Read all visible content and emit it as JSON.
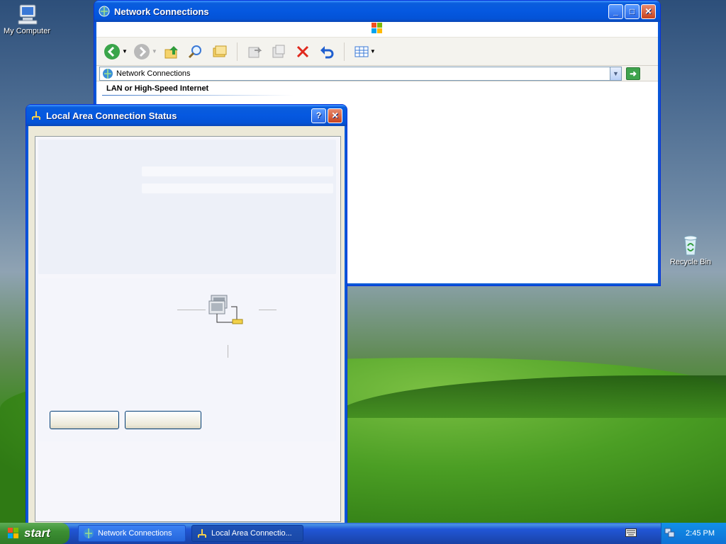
{
  "desktop": {
    "icons": [
      {
        "label": "My Computer"
      },
      {
        "label": "Recycle Bin"
      }
    ]
  },
  "network_window": {
    "title": "Network Connections",
    "address": "Network Connections",
    "group_header": "LAN or High-Speed Internet"
  },
  "status_dialog": {
    "title": "Local Area Connection Status"
  },
  "taskbar": {
    "start_label": "start",
    "tasks": [
      {
        "label": "Network Connections"
      },
      {
        "label": "Local Area Connectio..."
      }
    ],
    "clock": "2:45 PM"
  }
}
